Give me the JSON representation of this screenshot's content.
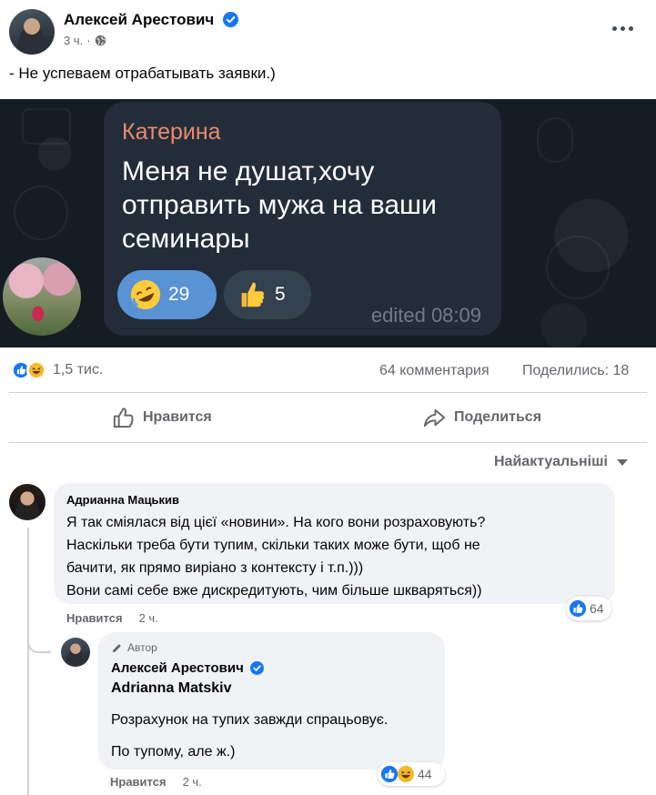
{
  "post": {
    "author": "Алексей Арестович",
    "time": "3 ч.",
    "text": "- Не успеваем отрабатывать заявки.)",
    "more_icon": "more-horizontal-icon",
    "privacy_icon": "globe-icon"
  },
  "shared_message": {
    "sender": "Катерина",
    "text": "Меня не душат,хочу отправить мужа на ваши семинары",
    "reactions": [
      {
        "emoji": "rolling-on-floor-laughing-emoji",
        "count": "29"
      },
      {
        "emoji": "thumbs-up-emoji",
        "count": "5"
      }
    ],
    "edited_time": "edited 08:09"
  },
  "stats": {
    "reactions_total": "1,5 тис.",
    "comments": "64 комментария",
    "shares": "Поделились: 18"
  },
  "actions": {
    "like": "Нравится",
    "share": "Поделиться"
  },
  "sort": {
    "selected": "Найактуальніші"
  },
  "comments": [
    {
      "author": "Адрианна Мацькив",
      "lines": [
        "Я так сміялася від цієї «новини». На кого вони розраховують?",
        "Наскільки треба бути тупим, скільки таких може бути, щоб не",
        "бачити, як прямо виріано з контексту і т.п.)))",
        "Вони самі себе вже дискредитують, чим більше шкваряться))"
      ],
      "reactions_count": "64",
      "like_label": "Нравится",
      "time": "2 ч."
    },
    {
      "badge": "Автор",
      "author": "Алексей Арестович",
      "tagged": "Adrianna Matskiv",
      "lines": [
        "Розрахунок на тупих завжди спрацьовує.",
        "По тупому, але ж.)"
      ],
      "reactions_count": "44",
      "like_label": "Нравится",
      "time": "2 ч."
    }
  ],
  "colors": {
    "facebook_blue": "#1877f2",
    "secondary_text": "#65676b",
    "comment_bg": "#f0f2f5",
    "telegram_bg": "#141c24",
    "telegram_bubble": "#222d39",
    "telegram_sender": "#e98b6b",
    "reaction_active": "#5a93d4"
  }
}
